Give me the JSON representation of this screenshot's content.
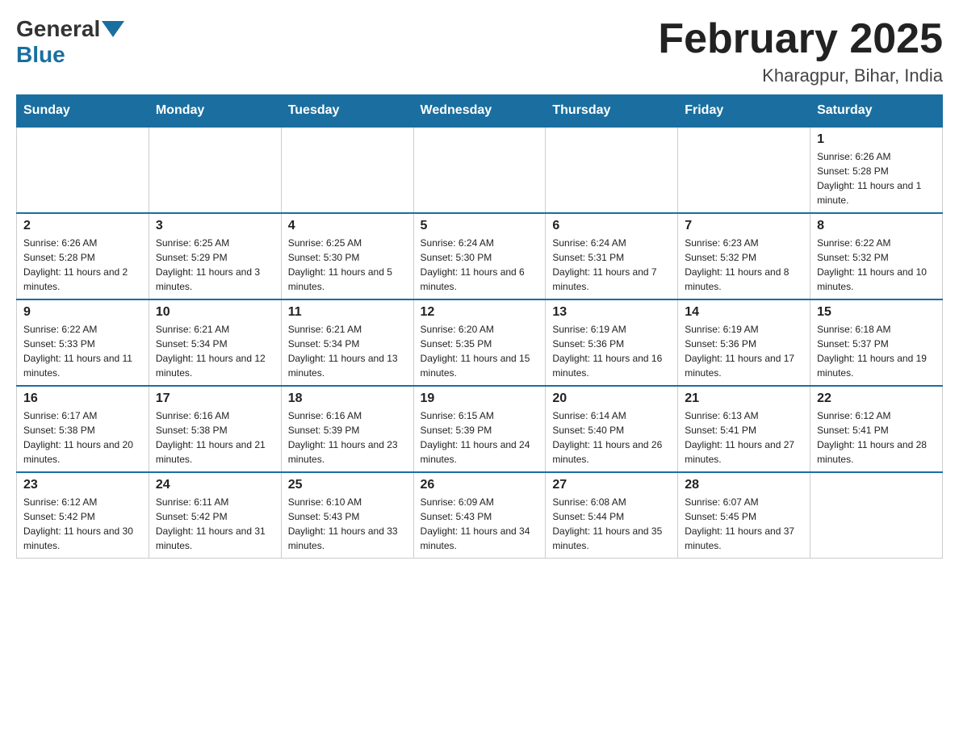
{
  "header": {
    "logo_general": "General",
    "logo_blue": "Blue",
    "month_title": "February 2025",
    "location": "Kharagpur, Bihar, India"
  },
  "days_of_week": [
    "Sunday",
    "Monday",
    "Tuesday",
    "Wednesday",
    "Thursday",
    "Friday",
    "Saturday"
  ],
  "weeks": [
    [
      {
        "day": "",
        "info": ""
      },
      {
        "day": "",
        "info": ""
      },
      {
        "day": "",
        "info": ""
      },
      {
        "day": "",
        "info": ""
      },
      {
        "day": "",
        "info": ""
      },
      {
        "day": "",
        "info": ""
      },
      {
        "day": "1",
        "info": "Sunrise: 6:26 AM\nSunset: 5:28 PM\nDaylight: 11 hours and 1 minute."
      }
    ],
    [
      {
        "day": "2",
        "info": "Sunrise: 6:26 AM\nSunset: 5:28 PM\nDaylight: 11 hours and 2 minutes."
      },
      {
        "day": "3",
        "info": "Sunrise: 6:25 AM\nSunset: 5:29 PM\nDaylight: 11 hours and 3 minutes."
      },
      {
        "day": "4",
        "info": "Sunrise: 6:25 AM\nSunset: 5:30 PM\nDaylight: 11 hours and 5 minutes."
      },
      {
        "day": "5",
        "info": "Sunrise: 6:24 AM\nSunset: 5:30 PM\nDaylight: 11 hours and 6 minutes."
      },
      {
        "day": "6",
        "info": "Sunrise: 6:24 AM\nSunset: 5:31 PM\nDaylight: 11 hours and 7 minutes."
      },
      {
        "day": "7",
        "info": "Sunrise: 6:23 AM\nSunset: 5:32 PM\nDaylight: 11 hours and 8 minutes."
      },
      {
        "day": "8",
        "info": "Sunrise: 6:22 AM\nSunset: 5:32 PM\nDaylight: 11 hours and 10 minutes."
      }
    ],
    [
      {
        "day": "9",
        "info": "Sunrise: 6:22 AM\nSunset: 5:33 PM\nDaylight: 11 hours and 11 minutes."
      },
      {
        "day": "10",
        "info": "Sunrise: 6:21 AM\nSunset: 5:34 PM\nDaylight: 11 hours and 12 minutes."
      },
      {
        "day": "11",
        "info": "Sunrise: 6:21 AM\nSunset: 5:34 PM\nDaylight: 11 hours and 13 minutes."
      },
      {
        "day": "12",
        "info": "Sunrise: 6:20 AM\nSunset: 5:35 PM\nDaylight: 11 hours and 15 minutes."
      },
      {
        "day": "13",
        "info": "Sunrise: 6:19 AM\nSunset: 5:36 PM\nDaylight: 11 hours and 16 minutes."
      },
      {
        "day": "14",
        "info": "Sunrise: 6:19 AM\nSunset: 5:36 PM\nDaylight: 11 hours and 17 minutes."
      },
      {
        "day": "15",
        "info": "Sunrise: 6:18 AM\nSunset: 5:37 PM\nDaylight: 11 hours and 19 minutes."
      }
    ],
    [
      {
        "day": "16",
        "info": "Sunrise: 6:17 AM\nSunset: 5:38 PM\nDaylight: 11 hours and 20 minutes."
      },
      {
        "day": "17",
        "info": "Sunrise: 6:16 AM\nSunset: 5:38 PM\nDaylight: 11 hours and 21 minutes."
      },
      {
        "day": "18",
        "info": "Sunrise: 6:16 AM\nSunset: 5:39 PM\nDaylight: 11 hours and 23 minutes."
      },
      {
        "day": "19",
        "info": "Sunrise: 6:15 AM\nSunset: 5:39 PM\nDaylight: 11 hours and 24 minutes."
      },
      {
        "day": "20",
        "info": "Sunrise: 6:14 AM\nSunset: 5:40 PM\nDaylight: 11 hours and 26 minutes."
      },
      {
        "day": "21",
        "info": "Sunrise: 6:13 AM\nSunset: 5:41 PM\nDaylight: 11 hours and 27 minutes."
      },
      {
        "day": "22",
        "info": "Sunrise: 6:12 AM\nSunset: 5:41 PM\nDaylight: 11 hours and 28 minutes."
      }
    ],
    [
      {
        "day": "23",
        "info": "Sunrise: 6:12 AM\nSunset: 5:42 PM\nDaylight: 11 hours and 30 minutes."
      },
      {
        "day": "24",
        "info": "Sunrise: 6:11 AM\nSunset: 5:42 PM\nDaylight: 11 hours and 31 minutes."
      },
      {
        "day": "25",
        "info": "Sunrise: 6:10 AM\nSunset: 5:43 PM\nDaylight: 11 hours and 33 minutes."
      },
      {
        "day": "26",
        "info": "Sunrise: 6:09 AM\nSunset: 5:43 PM\nDaylight: 11 hours and 34 minutes."
      },
      {
        "day": "27",
        "info": "Sunrise: 6:08 AM\nSunset: 5:44 PM\nDaylight: 11 hours and 35 minutes."
      },
      {
        "day": "28",
        "info": "Sunrise: 6:07 AM\nSunset: 5:45 PM\nDaylight: 11 hours and 37 minutes."
      },
      {
        "day": "",
        "info": ""
      }
    ]
  ]
}
